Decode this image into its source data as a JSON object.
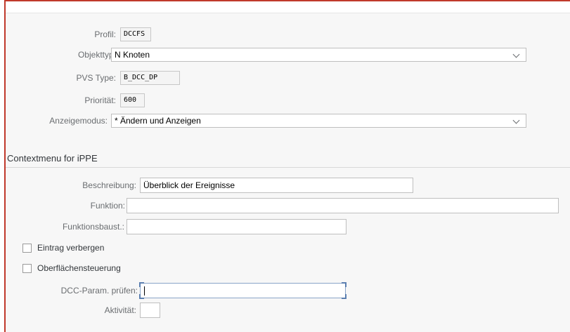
{
  "header": {
    "profile_label": "Profil:",
    "profile_value": "DCCFS",
    "objecttype_label": "Objekttyp:",
    "objecttype_value": "N Knoten",
    "pvs_type_label": "PVS Type:",
    "pvs_type_value": "B_DCC_DP",
    "priority_label": "Priorität:",
    "priority_value": "600",
    "display_mode_label": "Anzeigemodus:",
    "display_mode_value": "* Ändern und Anzeigen"
  },
  "context_menu": {
    "title": "Contextmenu for iPPE",
    "description_label": "Beschreibung:",
    "description_value": "Überblick der Ereignisse",
    "function_label": "Funktion:",
    "function_value": "",
    "function_module_label": "Funktionsbaust.:",
    "function_module_value": "",
    "hide_entry_label": "Eintrag verbergen",
    "hide_entry_checked": false,
    "ui_control_label": "Oberflächensteuerung",
    "ui_control_checked": false,
    "dcc_param_label": "DCC-Param. prüfen:",
    "dcc_param_value": "",
    "activity_label": "Aktivität:",
    "activity_value": ""
  },
  "colors": {
    "frame_border": "#c0392b",
    "focus_border": "#5b7fb0",
    "background": "#f7f7f7"
  }
}
